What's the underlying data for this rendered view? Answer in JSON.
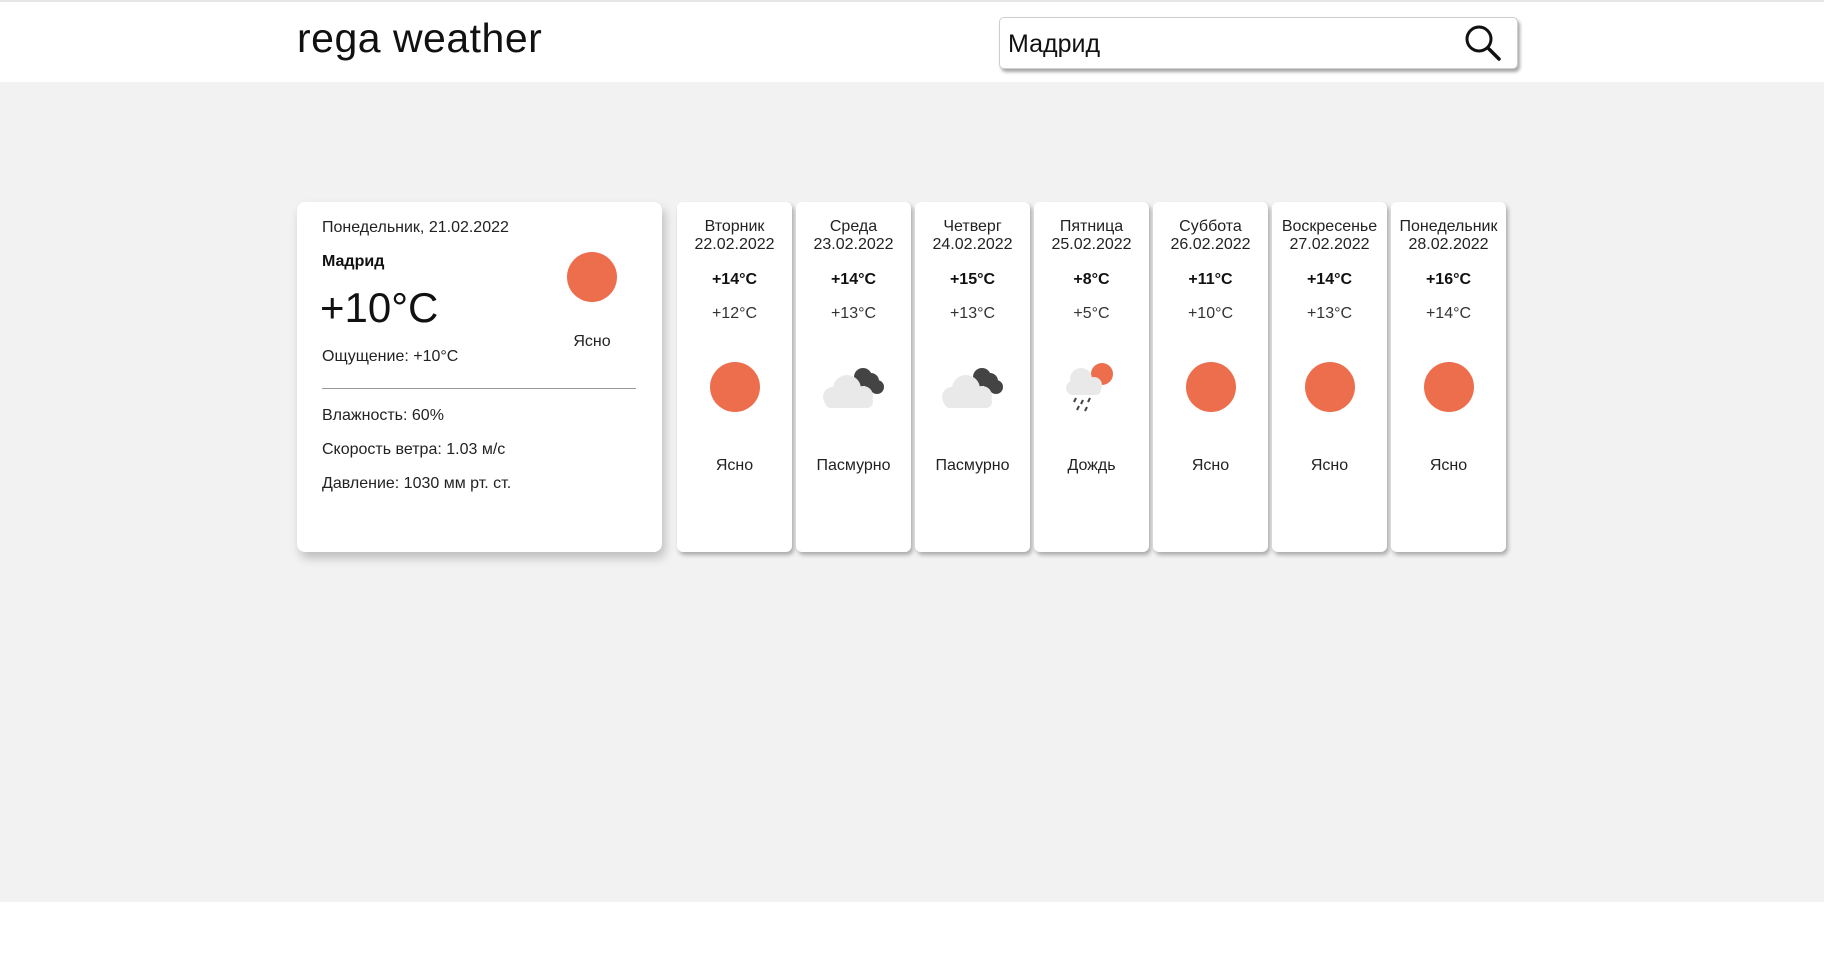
{
  "header": {
    "logo": "rega weather",
    "search_value": "Мадрид",
    "search_icon": "search-icon"
  },
  "colors": {
    "accent_sun": "#ec6e4c",
    "cloud_light": "#e9e9e9",
    "cloud_dark": "#444444",
    "background": "#f2f2f2"
  },
  "today": {
    "date": "Понедельник, 21.02.2022",
    "city": "Мадрид",
    "temp": "+10°C",
    "feels": "Ощущение: +10°C",
    "condition": "Ясно",
    "icon": "sun-icon",
    "humidity": "Влажность: 60%",
    "wind": "Скорость ветра: 1.03 м/с",
    "pressure": "Давление: 1030 мм рт. ст."
  },
  "forecast": [
    {
      "day": "Вторник",
      "date": "22.02.2022",
      "max": "+14°C",
      "min": "+12°C",
      "condition": "Ясно",
      "icon": "sun-icon"
    },
    {
      "day": "Среда",
      "date": "23.02.2022",
      "max": "+14°C",
      "min": "+13°C",
      "condition": "Пасмурно",
      "icon": "cloudy-icon"
    },
    {
      "day": "Четверг",
      "date": "24.02.2022",
      "max": "+15°C",
      "min": "+13°C",
      "condition": "Пасмурно",
      "icon": "cloudy-icon"
    },
    {
      "day": "Пятница",
      "date": "25.02.2022",
      "max": "+8°C",
      "min": "+5°C",
      "condition": "Дождь",
      "icon": "rain-icon"
    },
    {
      "day": "Суббота",
      "date": "26.02.2022",
      "max": "+11°C",
      "min": "+10°C",
      "condition": "Ясно",
      "icon": "sun-icon"
    },
    {
      "day": "Воскресенье",
      "date": "27.02.2022",
      "max": "+14°C",
      "min": "+13°C",
      "condition": "Ясно",
      "icon": "sun-icon"
    },
    {
      "day": "Понедельник",
      "date": "28.02.2022",
      "max": "+16°C",
      "min": "+14°C",
      "condition": "Ясно",
      "icon": "sun-icon"
    }
  ]
}
